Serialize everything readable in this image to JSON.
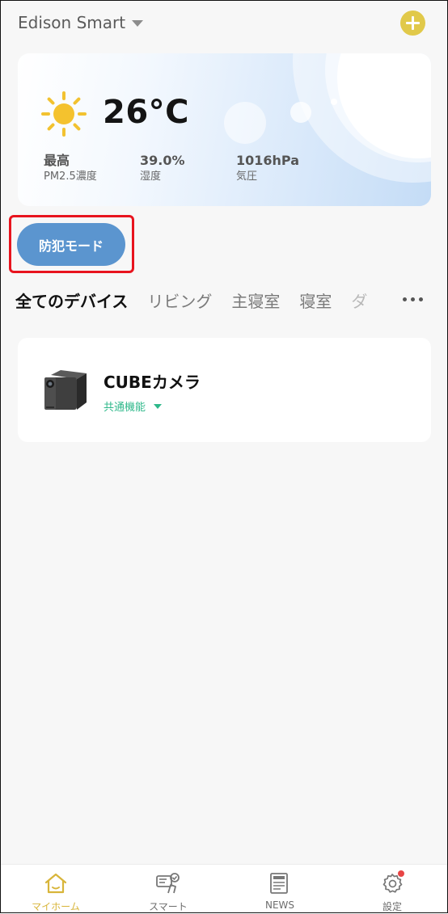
{
  "header": {
    "home_name": "Edison Smart"
  },
  "weather": {
    "temperature": "26°C",
    "stats": [
      {
        "value": "最高",
        "label": "PM2.5濃度"
      },
      {
        "value": "39.0%",
        "label": "湿度"
      },
      {
        "value": "1016hPa",
        "label": "気圧"
      }
    ]
  },
  "security_mode": {
    "label": "防犯モード"
  },
  "tabs": [
    "全てのデバイス",
    "リビング",
    "主寝室",
    "寝室",
    "ダ"
  ],
  "device": {
    "name": "CUBEカメラ",
    "function": "共通機能"
  },
  "bottom_nav": [
    {
      "label": "マイホーム"
    },
    {
      "label": "スマート"
    },
    {
      "label": "NEWS"
    },
    {
      "label": "設定"
    }
  ],
  "colors": {
    "accent": "#d8b53a",
    "add_button": "#e1c94a",
    "security_button": "#5b95cf",
    "highlight": "#e8141e",
    "function_text": "#2eb88a"
  }
}
